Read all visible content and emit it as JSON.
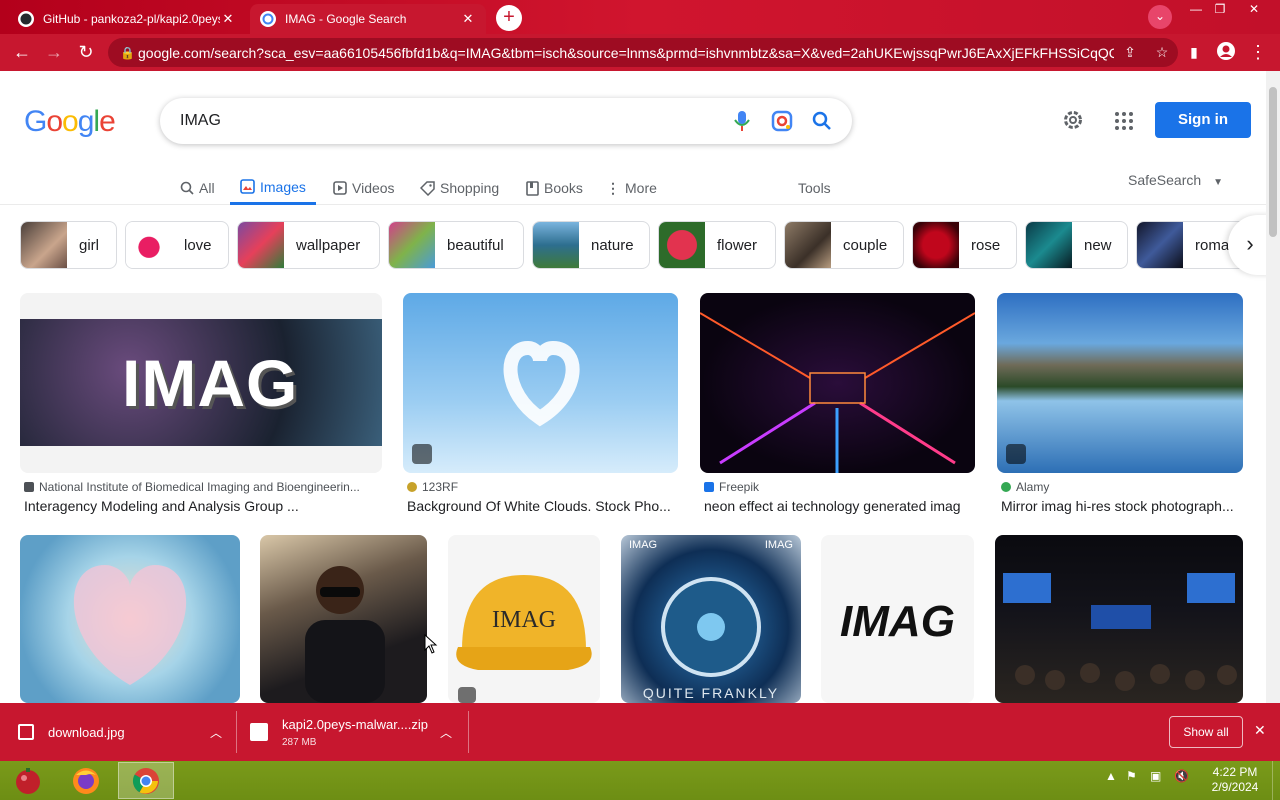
{
  "browser": {
    "tabs": [
      {
        "title": "GitHub - pankoza2-pl/kapi2.0peys",
        "active": false,
        "icon": "github-icon"
      },
      {
        "title": "IMAG - Google Search",
        "active": true,
        "icon": "google-icon"
      }
    ],
    "new_tab": "+",
    "url": "google.com/search?sca_esv=aa66105456fbfd1b&q=IMAG&tbm=isch&source=lnms&prmd=ishvnmbtz&sa=X&ved=2ahUKEwjssqPwrJ6EAxXjEFkFHSSiCqQQ0p..."
  },
  "google": {
    "logo": "Google",
    "query": "IMAG",
    "sign_in": "Sign in",
    "tabs": [
      {
        "label": "All",
        "icon": "search-icon"
      },
      {
        "label": "Images",
        "icon": "image-icon",
        "selected": true
      },
      {
        "label": "Videos",
        "icon": "video-icon"
      },
      {
        "label": "Shopping",
        "icon": "tag-icon"
      },
      {
        "label": "Books",
        "icon": "book-icon"
      },
      {
        "label": "More",
        "icon": "more-vert-icon"
      }
    ],
    "tools": "Tools",
    "safesearch": "SafeSearch",
    "chips": [
      "girl",
      "love",
      "wallpaper",
      "beautiful",
      "nature",
      "flower",
      "couple",
      "rose",
      "new",
      "roma"
    ],
    "results_row1": [
      {
        "source": "National Institute of Biomedical Imaging and Bioengineerin...",
        "caption": "Interagency Modeling and Analysis Group ...",
        "image_text": "IMAG"
      },
      {
        "source": "123RF",
        "caption": "Background Of White Clouds. Stock Pho..."
      },
      {
        "source": "Freepik",
        "caption": "neon effect ai technology generated imag"
      },
      {
        "source": "Alamy",
        "caption": "Mirror imag hi-res stock photograph..."
      }
    ],
    "results_row2_text": {
      "cap_text": "IMAG",
      "logo_text": "IMAG",
      "poster_top_left": "IMAG",
      "poster_top_right": "IMAG",
      "poster_bottom": "QUITE FRANKLY"
    }
  },
  "downloads": {
    "items": [
      {
        "name": "download.jpg",
        "size": ""
      },
      {
        "name": "kapi2.0peys-malwar....zip",
        "size": "287 MB"
      }
    ],
    "show_all": "Show all"
  },
  "taskbar": {
    "time": "4:22 PM",
    "date": "2/9/2024"
  },
  "colors": {
    "browser_frame": "#c7172f",
    "google_blue": "#1a73e8",
    "taskbar": "#6d8e14"
  }
}
